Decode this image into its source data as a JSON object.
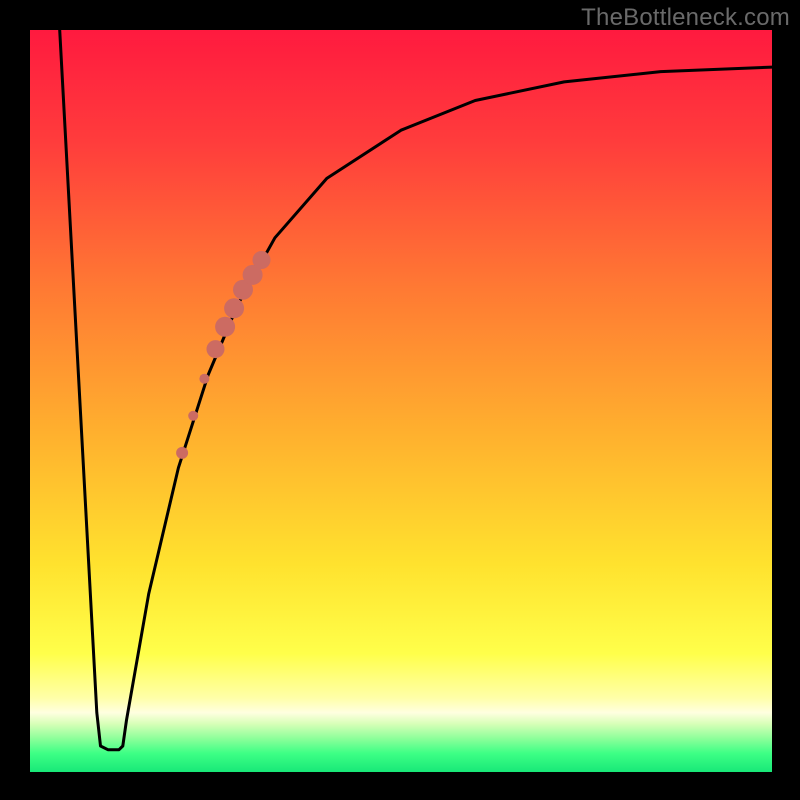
{
  "watermark": "TheBottleneck.com",
  "colors": {
    "frame": "#000000",
    "curve": "#000000",
    "dots": "#cc6b62",
    "gradient_stops": [
      {
        "offset": 0.0,
        "color": "#ff1a3f"
      },
      {
        "offset": 0.15,
        "color": "#ff3c3c"
      },
      {
        "offset": 0.35,
        "color": "#ff7a33"
      },
      {
        "offset": 0.55,
        "color": "#ffb22e"
      },
      {
        "offset": 0.72,
        "color": "#ffe22e"
      },
      {
        "offset": 0.84,
        "color": "#ffff4a"
      },
      {
        "offset": 0.9,
        "color": "#ffffa8"
      },
      {
        "offset": 0.92,
        "color": "#ffffe0"
      },
      {
        "offset": 0.935,
        "color": "#d8ffb8"
      },
      {
        "offset": 0.955,
        "color": "#8cff9a"
      },
      {
        "offset": 0.975,
        "color": "#3dff85"
      },
      {
        "offset": 1.0,
        "color": "#18e878"
      }
    ]
  },
  "chart_data": {
    "type": "line",
    "title": "",
    "xlabel": "",
    "ylabel": "",
    "xlim": [
      0,
      100
    ],
    "ylim": [
      0,
      100
    ],
    "curve": [
      {
        "x": 4.0,
        "y": 100.0
      },
      {
        "x": 9.0,
        "y": 8.0
      },
      {
        "x": 9.5,
        "y": 3.5
      },
      {
        "x": 10.5,
        "y": 3.0
      },
      {
        "x": 12.0,
        "y": 3.0
      },
      {
        "x": 12.5,
        "y": 3.5
      },
      {
        "x": 13.0,
        "y": 7.0
      },
      {
        "x": 16.0,
        "y": 24.0
      },
      {
        "x": 20.0,
        "y": 41.0
      },
      {
        "x": 24.0,
        "y": 53.5
      },
      {
        "x": 28.0,
        "y": 63.0
      },
      {
        "x": 33.0,
        "y": 72.0
      },
      {
        "x": 40.0,
        "y": 80.0
      },
      {
        "x": 50.0,
        "y": 86.5
      },
      {
        "x": 60.0,
        "y": 90.5
      },
      {
        "x": 72.0,
        "y": 93.0
      },
      {
        "x": 85.0,
        "y": 94.4
      },
      {
        "x": 100.0,
        "y": 95.0
      }
    ],
    "data_points": [
      {
        "x": 20.5,
        "y": 43.0,
        "r": 6
      },
      {
        "x": 22.0,
        "y": 48.0,
        "r": 5
      },
      {
        "x": 23.5,
        "y": 53.0,
        "r": 5
      },
      {
        "x": 25.0,
        "y": 57.0,
        "r": 9
      },
      {
        "x": 26.3,
        "y": 60.0,
        "r": 10
      },
      {
        "x": 27.5,
        "y": 62.5,
        "r": 10
      },
      {
        "x": 28.7,
        "y": 65.0,
        "r": 10
      },
      {
        "x": 30.0,
        "y": 67.0,
        "r": 10
      },
      {
        "x": 31.2,
        "y": 69.0,
        "r": 9
      }
    ]
  }
}
